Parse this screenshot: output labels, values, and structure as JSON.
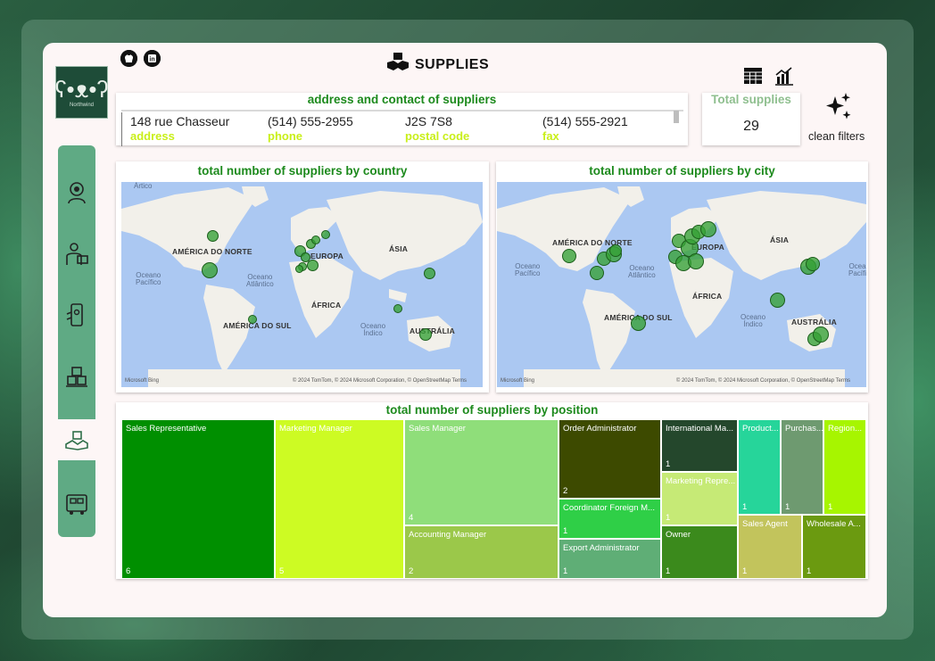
{
  "page": {
    "title": "SUPPLIES",
    "logo_text": "Northwind"
  },
  "social": [
    {
      "name": "github-icon",
      "glyph": "◉"
    },
    {
      "name": "linkedin-icon",
      "glyph": "in"
    }
  ],
  "sidebar": {
    "items": [
      {
        "name": "sidebar-item-customers",
        "icon": "customer-badge-icon"
      },
      {
        "name": "sidebar-item-employees",
        "icon": "employee-icon"
      },
      {
        "name": "sidebar-item-orders",
        "icon": "phone-order-icon"
      },
      {
        "name": "sidebar-item-products",
        "icon": "boxes-icon"
      },
      {
        "name": "sidebar-item-supplies",
        "icon": "supplies-icon",
        "active": true
      },
      {
        "name": "sidebar-item-shipping",
        "icon": "truck-icon"
      }
    ]
  },
  "address_panel": {
    "title": "address and contact of suppliers",
    "fields": [
      {
        "value": "148 rue Chasseur",
        "label": "address"
      },
      {
        "value": "(514) 555-2955",
        "label": "phone"
      },
      {
        "value": "J2S 7S8",
        "label": "postal code"
      },
      {
        "value": "(514) 555-2921",
        "label": "fax"
      }
    ]
  },
  "total_panel": {
    "title": "Total supplies",
    "value": "29"
  },
  "toolbar": {
    "table_icon": "table-icon",
    "chart_icon": "bar-chart-icon",
    "clean_filters_label": "clean filters"
  },
  "map_country": {
    "title": "total number of suppliers by country",
    "labels": {
      "north_america": "AMÉRICA DO NORTE",
      "europe": "EUROPA",
      "asia": "ÁSIA",
      "africa": "ÁFRICA",
      "south_america": "AMÉRICA DO SUL",
      "australia": "AUSTRÁLIA",
      "pacific": "Oceano\nPacífico",
      "atlantic": "Oceano\nAtlântico",
      "indian": "Oceano\nÍndico",
      "arctic": "Ártico"
    },
    "bing": "Microsoft Bing",
    "copyright": "© 2024 TomTom, © 2024 Microsoft Corporation, © OpenStreetMap  Terms"
  },
  "map_city": {
    "title": "total number of suppliers by city",
    "labels": {
      "north_america": "AMÉRICA DO NORTE",
      "europe": "EUROPA",
      "asia": "ÁSIA",
      "africa": "ÁFRICA",
      "south_america": "AMÉRICA DO SUL",
      "australia": "AUSTRÁLIA",
      "pacific": "Oceano\nPacífico",
      "atlantic": "Oceano\nAtlântico",
      "indian": "Oceano\nÍndico",
      "pacific_right": "Ocea\nPacífi"
    },
    "bing": "Microsoft Bing",
    "copyright": "© 2024 TomTom, © 2024 Microsoft Corporation, © OpenStreetMap  Terms"
  },
  "treemap": {
    "title": "total number of suppliers by position",
    "cells": [
      {
        "label": "Sales Representative",
        "value": "6",
        "color": "#008f00"
      },
      {
        "label": "Marketing Manager",
        "value": "5",
        "color": "#cdfb23"
      },
      {
        "label": "Sales Manager",
        "value": "4",
        "color": "#8fde7a"
      },
      {
        "label": "Accounting Manager",
        "value": "2",
        "color": "#9bc84a"
      },
      {
        "label": "Order Administrator",
        "value": "2",
        "color": "#3d4a00"
      },
      {
        "label": "Coordinator Foreign M...",
        "value": "1",
        "color": "#2fcf47"
      },
      {
        "label": "Export Administrator",
        "value": "1",
        "color": "#5fae76"
      },
      {
        "label": "International Ma...",
        "value": "1",
        "color": "#24472c"
      },
      {
        "label": "Marketing Repre...",
        "value": "1",
        "color": "#c6ea76"
      },
      {
        "label": "Owner",
        "value": "1",
        "color": "#3b8a1c"
      },
      {
        "label": "Product...",
        "value": "1",
        "color": "#26d59a"
      },
      {
        "label": "Purchas...",
        "value": "1",
        "color": "#6e9a70"
      },
      {
        "label": "Region...",
        "value": "1",
        "color": "#a7f500"
      },
      {
        "label": "Sales Agent",
        "value": "1",
        "color": "#c2c45c"
      },
      {
        "label": "Wholesale A...",
        "value": "1",
        "color": "#6b9a10"
      }
    ]
  },
  "colors": {
    "accent_green": "#1d8a1d",
    "label_yellow": "#c9ef1a",
    "sidebar": "#5faa84"
  }
}
